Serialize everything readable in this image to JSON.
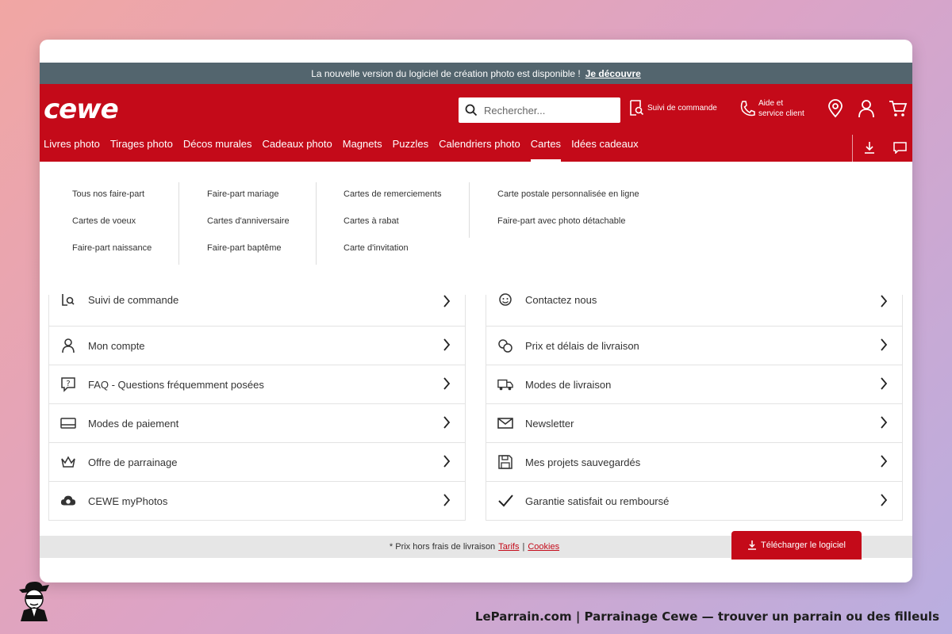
{
  "announcement": {
    "text": "La nouvelle version du logiciel de création photo est disponible !",
    "link": "Je découvre"
  },
  "header": {
    "logo": "cewe",
    "search_placeholder": "Rechercher...",
    "order_tracking": "Suivi de commande",
    "help_line1": "Aide et",
    "help_line2": "service client",
    "icons": [
      "location-pin-icon",
      "user-icon",
      "cart-icon",
      "download-icon",
      "chat-icon"
    ]
  },
  "nav": {
    "items": [
      "Livres photo",
      "Tirages photo",
      "Décos murales",
      "Cadeaux photo",
      "Magnets",
      "Puzzles",
      "Calendriers photo",
      "Cartes",
      "Idées cadeaux"
    ],
    "active": "Cartes"
  },
  "dropdown": {
    "columns": [
      [
        "Tous nos faire-part",
        "Cartes de voeux",
        "Faire-part naissance"
      ],
      [
        "Faire-part mariage",
        "Cartes d'anniversaire",
        "Faire-part baptême"
      ],
      [
        "Cartes de remerciements",
        "Cartes à rabat",
        "Carte d'invitation"
      ],
      [
        "Carte postale personnalisée en ligne",
        "Faire-part avec photo détachable"
      ]
    ]
  },
  "service_left": [
    "Suivi de commande",
    "Mon compte",
    "FAQ - Questions fréquemment posées",
    "Modes de paiement",
    "Offre de parrainage",
    "CEWE myPhotos"
  ],
  "service_right": [
    "Contactez nous",
    "Prix et délais de livraison",
    "Modes de livraison",
    "Newsletter",
    "Mes projets sauvegardés",
    "Garantie satisfait ou remboursé"
  ],
  "footer": {
    "text": "* Prix hors frais de livraison",
    "link1": "Tarifs",
    "separator": "|",
    "link2": "Cookies"
  },
  "download_button": "Télécharger le logiciel",
  "caption": "LeParrain.com | Parrainage Cewe — trouver un parrain ou des filleuls",
  "colors": {
    "brand_red": "#c40a19",
    "announce_bg": "#53656e",
    "footer_bg": "#e6e6e6"
  }
}
